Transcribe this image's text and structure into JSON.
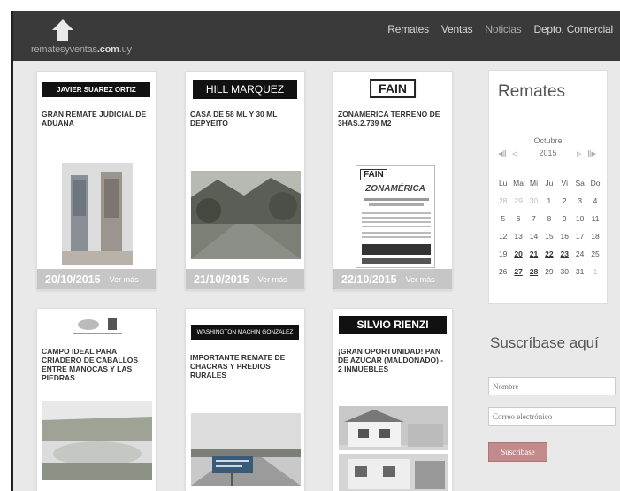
{
  "header": {
    "logo_text_light": "remates",
    "logo_text_mid": "yventas",
    "logo_text_bold": ".com",
    "logo_text_tld": ".uy",
    "nav": [
      "Remates",
      "Ventas",
      "Noticias",
      "Depto. Comercial"
    ]
  },
  "listings": [
    {
      "brand": "JAVIER SUAREZ ORTIZ",
      "title": "GRAN REMATE JUDICIAL DE ADUANA",
      "date": "20/10/2015",
      "more": "Ver más"
    },
    {
      "brand": "HILL MARQUEZ",
      "title": "CASA DE 58 ml y 30 ml Depyeito",
      "date": "21/10/2015",
      "more": "Ver más"
    },
    {
      "brand": "FAIN",
      "title": "ZONAMERICA TERRENO DE 3Has.2.739 m2",
      "date": "22/10/2015",
      "more": "Ver más",
      "flyer_brand": "FAIN",
      "flyer_headline": "ZONAMÉRICA"
    },
    {
      "brand": "",
      "title": "CAMPO IDEAL PARA CRIADERO DE CABALLOS ENTRE MANOCAS Y LAS PIEDRAS"
    },
    {
      "brand": "WASHINGTON MACHIN GONZALEZ",
      "title": "IMPORTANTE REMATE DE CHACRAS Y PREDIOS RURALES"
    },
    {
      "brand": "SILVIO RIENZI",
      "title": "¡GRAN OPORTUNIDAD! PAN DE AZUCAR (MALDONADO) - 2 INMUEBLES"
    }
  ],
  "calendar": {
    "title": "Remates",
    "month": "Octubre",
    "year": "2015",
    "weekdays": [
      "Lu",
      "Ma",
      "Mi",
      "Ju",
      "Vi",
      "Sa",
      "Do"
    ],
    "weeks": [
      [
        "28",
        "29",
        "30",
        "1",
        "2",
        "3",
        "4"
      ],
      [
        "5",
        "6",
        "7",
        "8",
        "9",
        "10",
        "11"
      ],
      [
        "12",
        "13",
        "14",
        "15",
        "16",
        "17",
        "18"
      ],
      [
        "19",
        "20",
        "21",
        "22",
        "23",
        "24",
        "25"
      ],
      [
        "26",
        "27",
        "28",
        "29",
        "30",
        "31",
        "1"
      ]
    ]
  },
  "subscribe": {
    "title": "Suscríbase aquí",
    "name_placeholder": "Nombre",
    "email_placeholder": "Correo electrónico",
    "button": "Suscríbase"
  }
}
